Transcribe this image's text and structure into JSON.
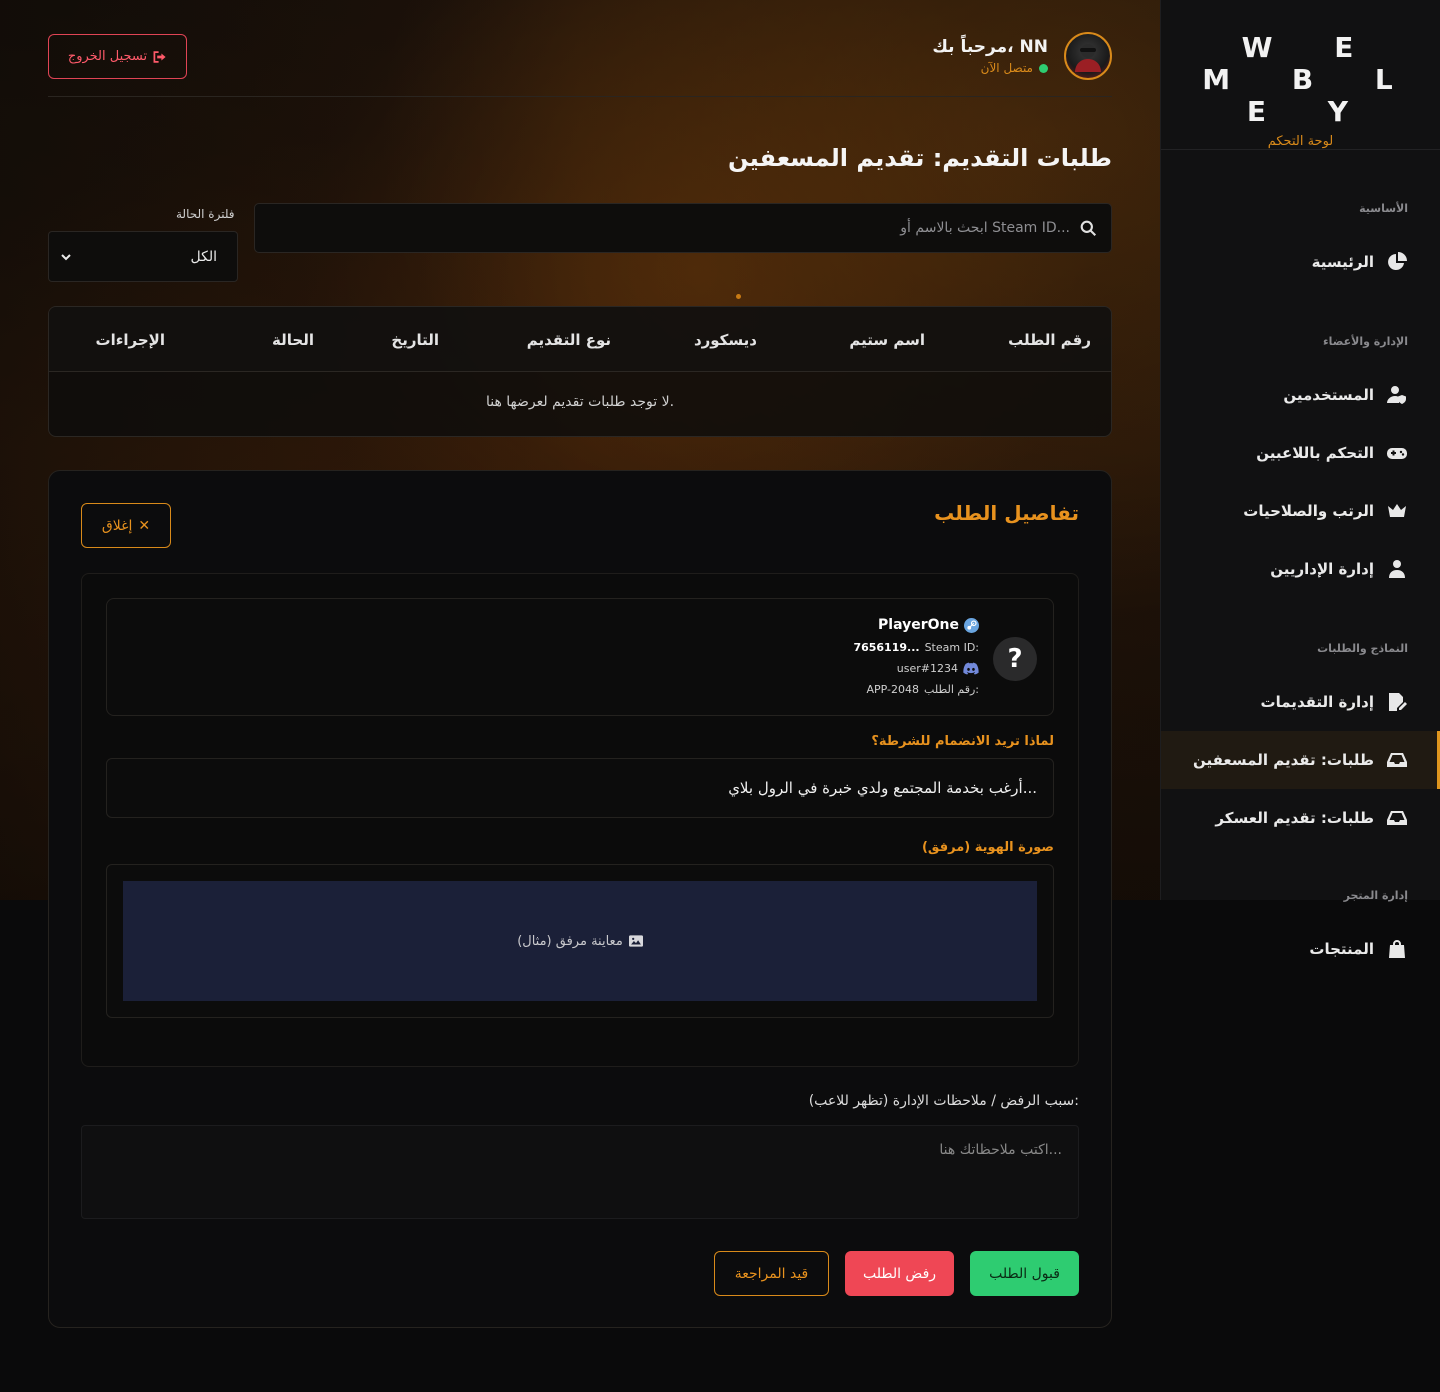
{
  "sidebar": {
    "brand": "W E M B L E Y",
    "subtitle": "لوحة التحكم",
    "sections": [
      {
        "title": "الأساسية",
        "items": [
          {
            "label": "الرئيسية",
            "icon": "chart-pie-icon"
          }
        ]
      },
      {
        "title": "الإدارة والأعضاء",
        "items": [
          {
            "label": "المستخدمين",
            "icon": "user-shield-icon"
          },
          {
            "label": "التحكم باللاعبين",
            "icon": "gamepad-icon"
          },
          {
            "label": "الرتب والصلاحيات",
            "icon": "crown-icon"
          },
          {
            "label": "إدارة الإداريين",
            "icon": "user-tie-icon"
          }
        ]
      },
      {
        "title": "النماذج والطلبات",
        "items": [
          {
            "label": "إدارة التقديمات",
            "icon": "file-signature-icon"
          },
          {
            "label": "طلبات: تقديم المسعفين",
            "icon": "inbox-icon",
            "active": true
          },
          {
            "label": "طلبات: تقديم العسكر",
            "icon": "inbox-icon"
          }
        ]
      },
      {
        "title": "إدارة المتجر",
        "items": [
          {
            "label": "المنتجات",
            "icon": "shopping-bag-icon"
          }
        ]
      }
    ]
  },
  "header": {
    "logout_label": "تسجيل الخروج",
    "welcome": "مرحباً بك، NN",
    "status": "متصل الآن"
  },
  "page": {
    "title": "طلبات التقديم: تقديم المسعفين",
    "search_placeholder": "ابحث بالاسم أو Steam ID...",
    "filter_label": "فلترة الحالة",
    "filter_value": "الكل"
  },
  "table": {
    "headers": [
      "رقم الطلب",
      "اسم ستيم",
      "ديسكورد",
      "نوع التقديم",
      "التاريخ",
      "الحالة",
      "الإجراءات"
    ],
    "empty_text": "لا توجد طلبات تقديم لعرضها هنا."
  },
  "details": {
    "title": "تفاصيل الطلب",
    "close_label": "إغلاق",
    "player": {
      "name": "PlayerOne",
      "steam_label": "Steam ID:",
      "steam_value": "7656119...",
      "discord": "user#1234",
      "request_label": "رقم الطلب:",
      "request_id": "APP-2048"
    },
    "question": "لماذا تريد الانضمام للشرطة؟",
    "answer": "أرغب بخدمة المجتمع ولدي خبرة في الرول بلاي...",
    "attachment_label": "صورة الهوية (مرفق)",
    "attachment_preview": "معاينة مرفق (مثال)",
    "notes_label": "سبب الرفض / ملاحظات الإدارة (تظهر للاعب):",
    "notes_placeholder": "اكتب ملاحظاتك هنا...",
    "accept_label": "قبول الطلب",
    "reject_label": "رفض الطلب",
    "review_label": "قيد المراجعة"
  },
  "colors": {
    "accent": "#e8921e",
    "accept": "#2ecc71",
    "reject": "#ef4755",
    "online": "#2ecc71"
  }
}
